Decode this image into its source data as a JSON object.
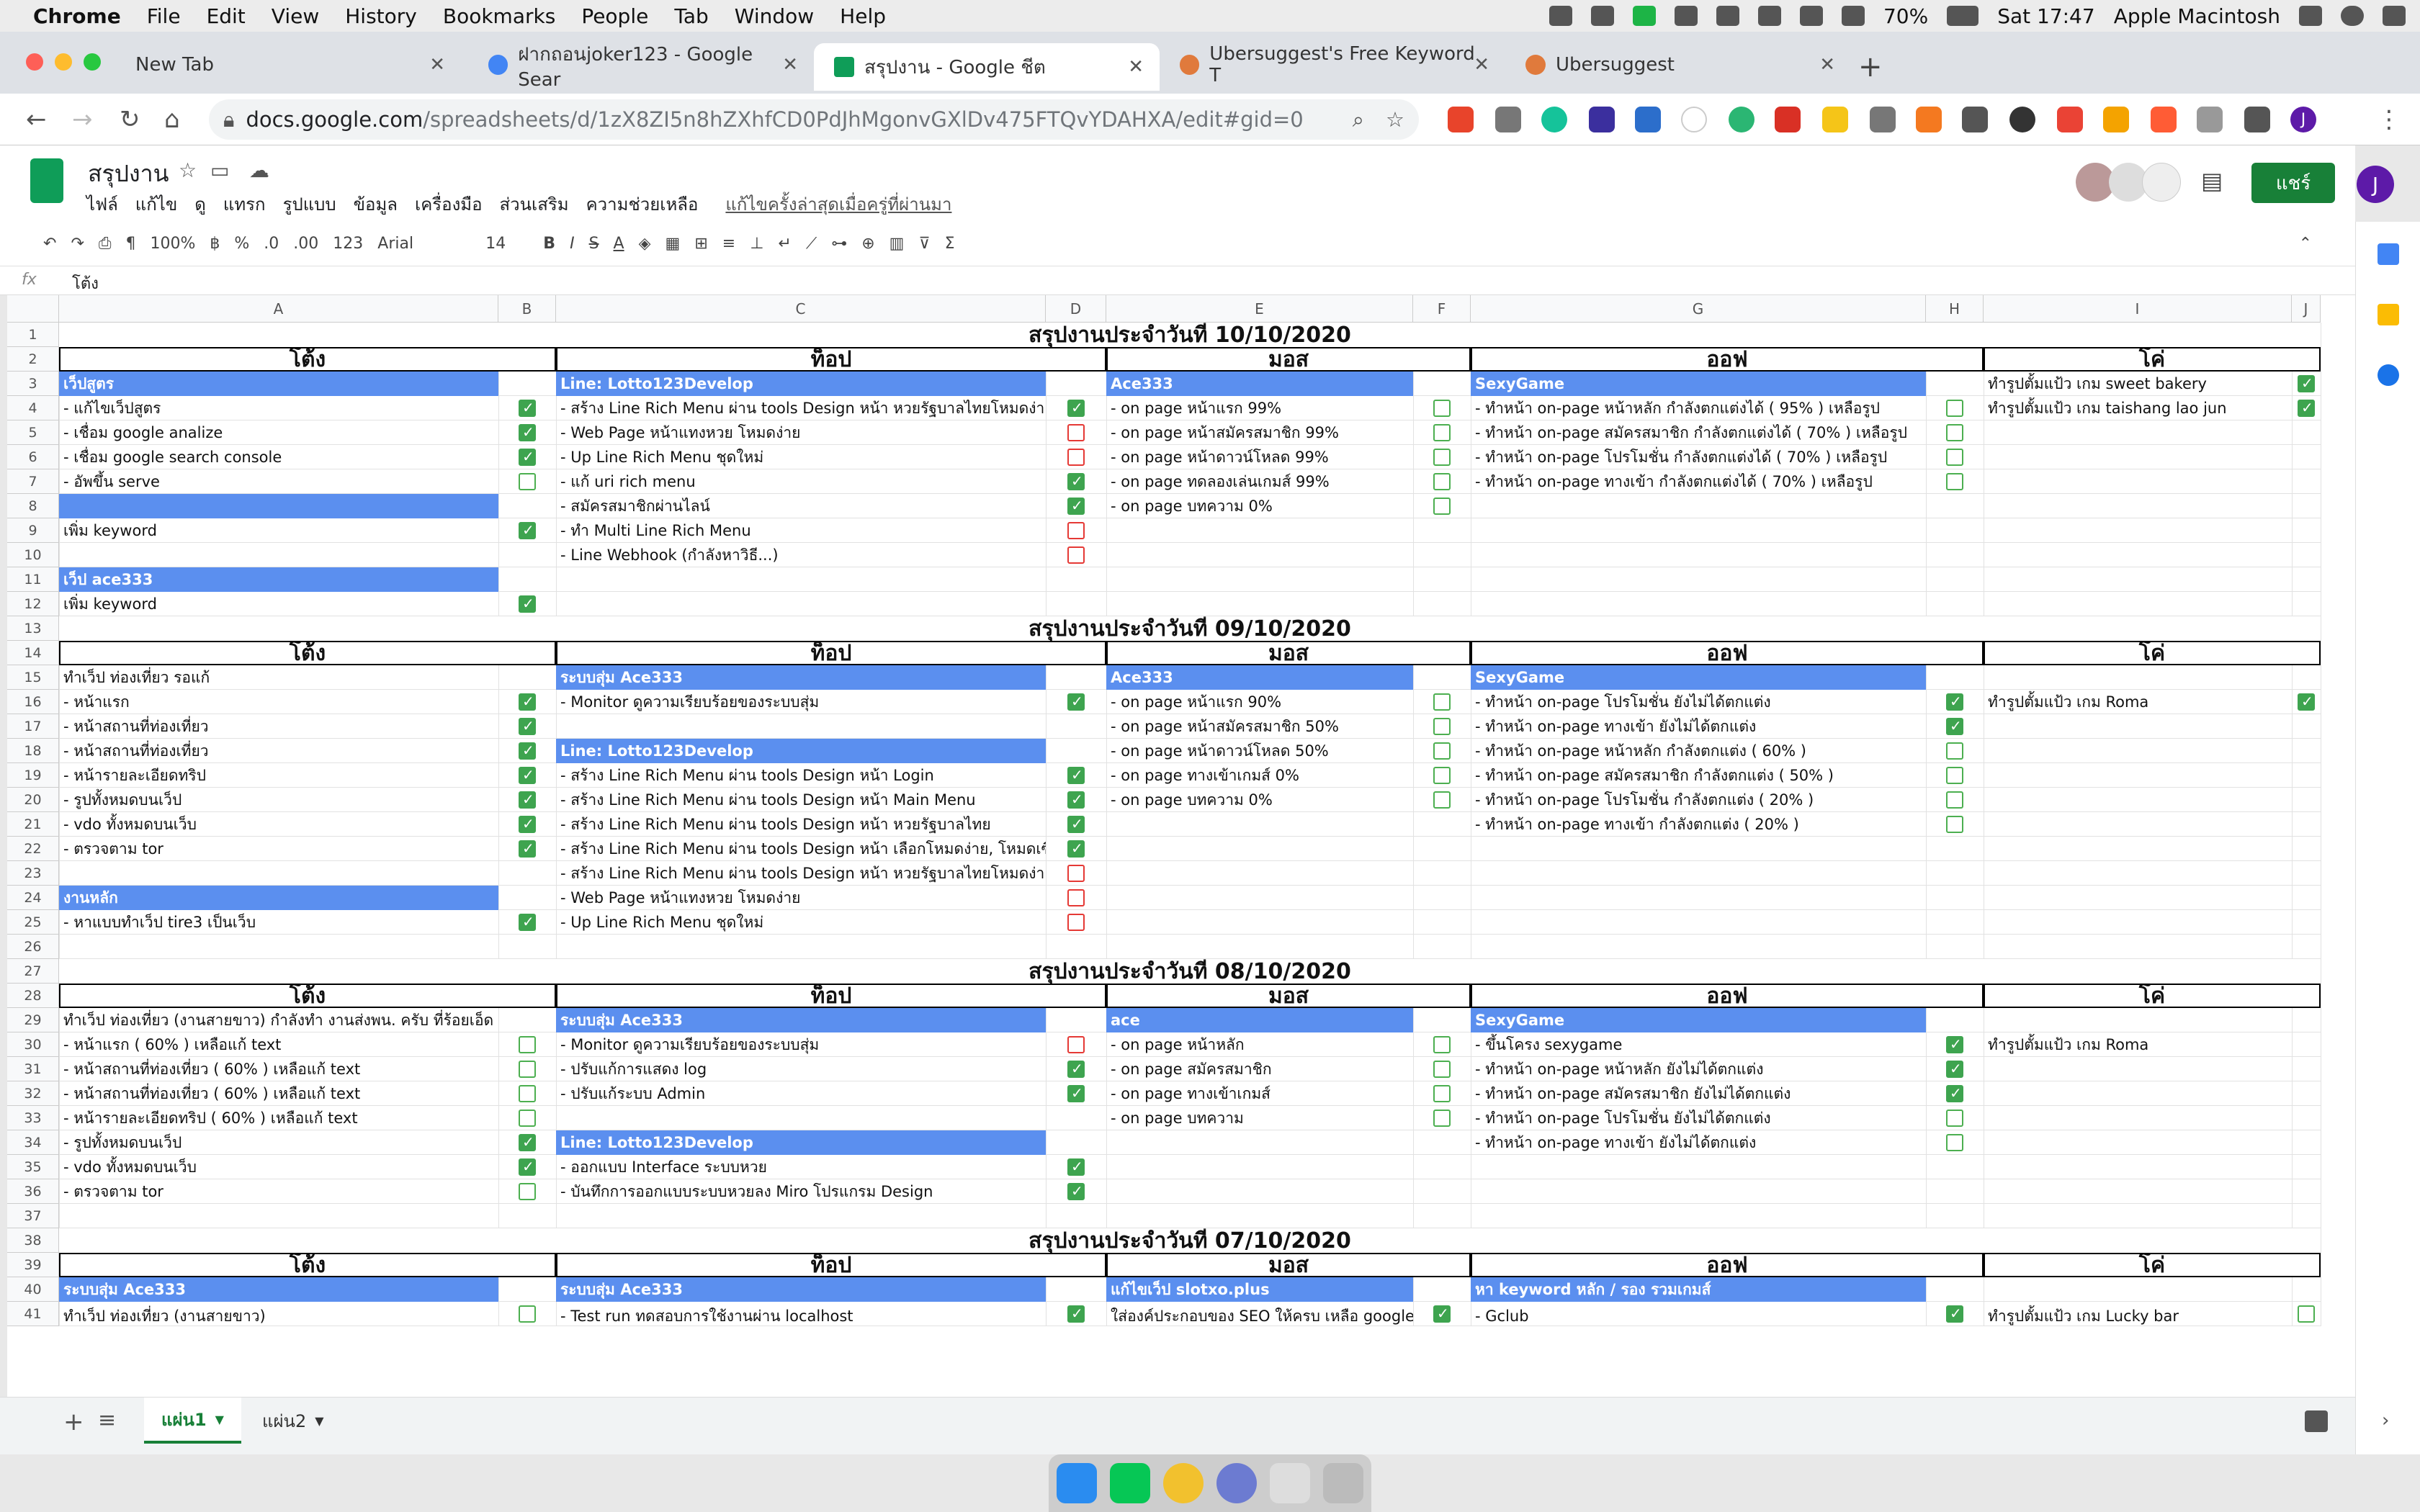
{
  "macbar": {
    "apple": "",
    "menu": [
      "Chrome",
      "File",
      "Edit",
      "View",
      "History",
      "Bookmarks",
      "People",
      "Tab",
      "Window",
      "Help"
    ],
    "battery": "70%",
    "clock": "Sat 17:47",
    "user": "Apple Macintosh"
  },
  "browser": {
    "tabs": [
      {
        "title": "New Tab"
      },
      {
        "title": "ฝากถอนjoker123 - Google Sear"
      },
      {
        "title": "สรุปงาน - Google ชีต"
      },
      {
        "title": "Ubersuggest's Free Keyword T"
      },
      {
        "title": "Ubersuggest"
      }
    ],
    "url_host": "docs.google.com",
    "url_path": "/spreadsheets/d/1zX8ZI5n8hZXhfCD0PdJhMgonvGXlDv475FTQvYDAHXA/edit#gid=0",
    "profile_initial": "J"
  },
  "sheets": {
    "doc_title": "สรุปงาน",
    "menus": [
      "ไฟล์",
      "แก้ไข",
      "ดู",
      "แทรก",
      "รูปแบบ",
      "ข้อมูล",
      "เครื่องมือ",
      "ส่วนเสริม",
      "ความช่วยเหลือ"
    ],
    "last_edit": "แก้ไขครั้งล่าสุดเมื่อครู่ที่ผ่านมา",
    "share": "แชร์",
    "account_initial": "J",
    "zoom": "100%",
    "font": "Arial",
    "font_size": "14",
    "currency": "฿",
    "percent": "%",
    "dec_less": ".0",
    "dec_more": ".00",
    "number_fmt": "123",
    "fx_label": "fx",
    "fx_value": "โต้ง",
    "sheet_tabs": [
      "แผ่น1",
      "แผ่น2"
    ]
  },
  "grid": {
    "cols": [
      "A",
      "B",
      "C",
      "D",
      "E",
      "F",
      "G",
      "H",
      "I",
      "J"
    ],
    "rows": [
      "1",
      "2",
      "3",
      "4",
      "5",
      "6",
      "7",
      "8",
      "9",
      "10",
      "11",
      "12",
      "13",
      "14",
      "15",
      "16",
      "17",
      "18",
      "19",
      "20",
      "21",
      "22",
      "23",
      "24",
      "25",
      "26",
      "27",
      "28",
      "29",
      "30",
      "31",
      "32",
      "33",
      "34",
      "35",
      "36",
      "37",
      "38",
      "39",
      "40",
      "41"
    ],
    "titles": [
      "สรุปงานประจำวันที่ 10/10/2020",
      "สรุปงานประจำวันที่ 09/10/2020",
      "สรุปงานประจำวันที่ 08/10/2020",
      "สรุปงานประจำวันที่ 07/10/2020"
    ],
    "people": [
      "โต้ง",
      "ท็อป",
      "มอส",
      "ออฟ",
      "โค่"
    ],
    "s1": {
      "tong": [
        {
          "r": 3,
          "t": "เว็ปสูตร",
          "blue": true
        },
        {
          "r": 4,
          "t": "- แก้ไขเว็ปสูตร",
          "cb": "on"
        },
        {
          "r": 5,
          "t": "- เชื่อม google analize",
          "cb": "on"
        },
        {
          "r": 6,
          "t": "- เชื่อม google search console",
          "cb": "on"
        },
        {
          "r": 7,
          "t": "- อัพขึ้น serve",
          "cb": "off"
        },
        {
          "r": 8,
          "t": "",
          "blue": true
        },
        {
          "r": 9,
          "t": "เพิ่ม keyword",
          "cb": "on"
        },
        {
          "r": 11,
          "t": "เว็ป ace333",
          "blue": true
        },
        {
          "r": 12,
          "t": "เพิ่ม keyword",
          "cb": "on"
        }
      ],
      "top": [
        {
          "r": 3,
          "t": "Line: Lotto123Develop",
          "blue": true
        },
        {
          "r": 4,
          "t": "- สร้าง Line Rich Menu ผ่าน tools Design หน้า หวยรัฐบาลไทยโหมดง่าย",
          "cb": "on"
        },
        {
          "r": 5,
          "t": "- Web Page หน้าแทงหวย โหมดง่าย",
          "cb": "red"
        },
        {
          "r": 6,
          "t": "- Up Line Rich Menu ชุดใหม่",
          "cb": "red"
        },
        {
          "r": 7,
          "t": "- แก้ uri rich menu",
          "cb": "on"
        },
        {
          "r": 8,
          "t": "- สมัครสมาชิกผ่านไลน์",
          "cb": "on"
        },
        {
          "r": 9,
          "t": "- ทำ Multi Line Rich Menu",
          "cb": "red"
        },
        {
          "r": 10,
          "t": "- Line Webhook (กำลังหาวิธี...)",
          "cb": "red"
        }
      ],
      "mos": [
        {
          "r": 3,
          "t": "Ace333",
          "blue": true
        },
        {
          "r": 4,
          "t": "- on page หน้าแรก 99%",
          "cb": "off"
        },
        {
          "r": 5,
          "t": "- on page หน้าสมัครสมาชิก 99%",
          "cb": "off"
        },
        {
          "r": 6,
          "t": "- on page หน้าดาวน์โหลด 99%",
          "cb": "off"
        },
        {
          "r": 7,
          "t": "- on page ทดลองเล่นเกมส์ 99%",
          "cb": "off"
        },
        {
          "r": 8,
          "t": "- on page บทความ 0%",
          "cb": "off"
        }
      ],
      "off": [
        {
          "r": 3,
          "t": "SexyGame",
          "blue": true
        },
        {
          "r": 4,
          "t": "- ทำหน้า on-page หน้าหลัก กำลังตกแต่งได้ ( 95% ) เหลือรูป",
          "cb": "off"
        },
        {
          "r": 5,
          "t": "- ทำหน้า on-page สมัครสมาชิก กำลังตกแต่งได้ ( 70% ) เหลือรูป",
          "cb": "off"
        },
        {
          "r": 6,
          "t": "- ทำหน้า on-page โปรโมชั่น กำลังตกแต่งได้ ( 70% ) เหลือรูป",
          "cb": "off"
        },
        {
          "r": 7,
          "t": "- ทำหน้า on-page ทางเข้า กำลังตกแต่งได้ ( 70% ) เหลือรูป",
          "cb": "off"
        }
      ],
      "ko": [
        {
          "r": 3,
          "t": "ทำรูปตั้มแป้ว เกม sweet bakery",
          "cb": "on"
        },
        {
          "r": 4,
          "t": "ทำรูปตั้มแป้ว เกม taishang lao jun",
          "cb": "on"
        }
      ]
    },
    "s2": {
      "tong": [
        {
          "r": 15,
          "t": "ทำเว็ป ท่องเที่ยว รอแก้"
        },
        {
          "r": 16,
          "t": "- หน้าแรก",
          "cb": "on"
        },
        {
          "r": 17,
          "t": "- หน้าสถานที่ท่องเที่ยว",
          "cb": "on"
        },
        {
          "r": 18,
          "t": "- หน้าสถานที่ท่องเที่ยว",
          "cb": "on"
        },
        {
          "r": 19,
          "t": "- หน้ารายละเอียดทริป",
          "cb": "on"
        },
        {
          "r": 20,
          "t": "- รูปทั้งหมดบนเว็ป",
          "cb": "on"
        },
        {
          "r": 21,
          "t": "- vdo ทั้งหมดบนเว็บ",
          "cb": "on"
        },
        {
          "r": 22,
          "t": "- ตรวจตาม tor",
          "cb": "on"
        },
        {
          "r": 24,
          "t": "งานหลัก",
          "blue": true
        },
        {
          "r": 25,
          "t": "- หาแบบทำเว็ป tire3 เป็นเว็บ",
          "cb": "on"
        }
      ],
      "top": [
        {
          "r": 15,
          "t": "ระบบสุ่ม Ace333",
          "blue": true
        },
        {
          "r": 16,
          "t": "- Monitor ดูความเรียบร้อยของระบบสุ่ม",
          "cb": "on"
        },
        {
          "r": 18,
          "t": "Line: Lotto123Develop",
          "blue": true
        },
        {
          "r": 19,
          "t": "- สร้าง Line Rich Menu ผ่าน tools Design หน้า Login",
          "cb": "on"
        },
        {
          "r": 20,
          "t": "- สร้าง Line Rich Menu ผ่าน tools Design หน้า Main Menu",
          "cb": "on"
        },
        {
          "r": 21,
          "t": "- สร้าง Line Rich Menu ผ่าน tools Design หน้า หวยรัฐบาลไทย",
          "cb": "on"
        },
        {
          "r": 22,
          "t": "- สร้าง Line Rich Menu ผ่าน tools Design หน้า เลือกโหมดง่าย, โหมดเซียน",
          "cb": "on"
        },
        {
          "r": 23,
          "t": "- สร้าง Line Rich Menu ผ่าน tools Design หน้า หวยรัฐบาลไทยโหมดง่าย",
          "cb": "red"
        },
        {
          "r": 24,
          "t": "- Web Page หน้าแทงหวย โหมดง่าย",
          "cb": "red"
        },
        {
          "r": 25,
          "t": "- Up Line Rich Menu ชุดใหม่",
          "cb": "red"
        }
      ],
      "mos": [
        {
          "r": 15,
          "t": "Ace333",
          "blue": true
        },
        {
          "r": 16,
          "t": "- on page หน้าแรก 90%",
          "cb": "off"
        },
        {
          "r": 17,
          "t": "- on page หน้าสมัครสมาชิก 50%",
          "cb": "off"
        },
        {
          "r": 18,
          "t": "- on page หน้าดาวน์โหลด 50%",
          "cb": "off"
        },
        {
          "r": 19,
          "t": "- on page ทางเข้าเกมส์ 0%",
          "cb": "off"
        },
        {
          "r": 20,
          "t": "- on page บทความ 0%",
          "cb": "off"
        }
      ],
      "off": [
        {
          "r": 15,
          "t": "SexyGame",
          "blue": true
        },
        {
          "r": 16,
          "t": "- ทำหน้า on-page โปรโมชั่น ยังไม่ได้ตกแต่ง",
          "cb": "on"
        },
        {
          "r": 17,
          "t": "- ทำหน้า on-page ทางเข้า ยังไม่ได้ตกแต่ง",
          "cb": "on"
        },
        {
          "r": 18,
          "t": "- ทำหน้า on-page หน้าหลัก กำลังตกแต่ง ( 60% )",
          "cb": "off"
        },
        {
          "r": 19,
          "t": "- ทำหน้า on-page สมัครสมาชิก กำลังตกแต่ง ( 50% )",
          "cb": "off"
        },
        {
          "r": 20,
          "t": "- ทำหน้า on-page โปรโมชั่น กำลังตกแต่ง ( 20% )",
          "cb": "off"
        },
        {
          "r": 21,
          "t": "- ทำหน้า on-page ทางเข้า กำลังตกแต่ง ( 20% )",
          "cb": "off"
        }
      ],
      "ko": [
        {
          "r": 16,
          "t": "ทำรูปตั้มแป้ว เกม Roma",
          "cb": "on"
        }
      ]
    },
    "s3": {
      "tong": [
        {
          "r": 29,
          "t": "ทำเว็ป ท่องเที่ยว (งานสายขาว) กำลังทำ งานส่งพน. ครับ ที่ร้อยเอ็ด"
        },
        {
          "r": 30,
          "t": "- หน้าแรก ( 60% ) เหลือแก้ text",
          "cb": "off"
        },
        {
          "r": 31,
          "t": "- หน้าสถานที่ท่องเที่ยว ( 60% ) เหลือแก้ text",
          "cb": "off"
        },
        {
          "r": 32,
          "t": "- หน้าสถานที่ท่องเที่ยว ( 60% ) เหลือแก้ text",
          "cb": "off"
        },
        {
          "r": 33,
          "t": "- หน้ารายละเอียดทริป ( 60% ) เหลือแก้ text",
          "cb": "off"
        },
        {
          "r": 34,
          "t": "- รูปทั้งหมดบนเว็ป",
          "cb": "on"
        },
        {
          "r": 35,
          "t": "- vdo ทั้งหมดบนเว็บ",
          "cb": "on"
        },
        {
          "r": 36,
          "t": "- ตรวจตาม tor",
          "cb": "off"
        }
      ],
      "top": [
        {
          "r": 29,
          "t": "ระบบสุ่ม Ace333",
          "blue": true
        },
        {
          "r": 30,
          "t": "- Monitor ดูความเรียบร้อยของระบบสุ่ม",
          "cb": "red"
        },
        {
          "r": 31,
          "t": "- ปรับแก้การแสดง log",
          "cb": "on"
        },
        {
          "r": 32,
          "t": "- ปรับแก้ระบบ Admin",
          "cb": "on"
        },
        {
          "r": 34,
          "t": "Line: Lotto123Develop",
          "blue": true
        },
        {
          "r": 35,
          "t": "- ออกแบบ Interface ระบบหวย",
          "cb": "on"
        },
        {
          "r": 36,
          "t": "- บันทึกการออกแบบระบบหวยลง Miro โปรแกรม Design",
          "cb": "on"
        }
      ],
      "mos": [
        {
          "r": 29,
          "t": "ace",
          "blue": true
        },
        {
          "r": 30,
          "t": " - on page หน้าหลัก",
          "cb": "off"
        },
        {
          "r": 31,
          "t": "- on page สมัครสมาชิก",
          "cb": "off"
        },
        {
          "r": 32,
          "t": "- on page ทางเข้าเกมส์",
          "cb": "off"
        },
        {
          "r": 33,
          "t": "- on page บทความ",
          "cb": "off"
        }
      ],
      "off": [
        {
          "r": 29,
          "t": "SexyGame",
          "blue": true
        },
        {
          "r": 30,
          "t": "- ขึ้นโครง sexygame",
          "cb": "on"
        },
        {
          "r": 31,
          "t": "- ทำหน้า on-page หน้าหลัก ยังไม่ได้ตกแต่ง",
          "cb": "on"
        },
        {
          "r": 32,
          "t": "- ทำหน้า on-page สมัครสมาชิก ยังไม่ได้ตกแต่ง",
          "cb": "on"
        },
        {
          "r": 33,
          "t": "- ทำหน้า on-page โปรโมชั่น ยังไม่ได้ตกแต่ง",
          "cb": "off"
        },
        {
          "r": 34,
          "t": "- ทำหน้า on-page ทางเข้า ยังไม่ได้ตกแต่ง",
          "cb": "off"
        }
      ],
      "ko": [
        {
          "r": 30,
          "t": "ทำรูปตั้มแป้ว เกม Roma"
        }
      ]
    },
    "s4": {
      "tong": [
        {
          "r": 40,
          "t": "ระบบสุ่ม Ace333",
          "blue": true
        },
        {
          "r": 41,
          "t": "ทำเว็ป ท่องเที่ยว (งานสายขาว)",
          "cb": "off"
        }
      ],
      "top": [
        {
          "r": 40,
          "t": "ระบบสุ่ม Ace333",
          "blue": true
        },
        {
          "r": 41,
          "t": "- Test run ทดสอบการใช้งานผ่าน localhost",
          "cb": "on"
        }
      ],
      "mos": [
        {
          "r": 40,
          "t": "แก้ไขเว็ป slotxo.plus",
          "blue": true
        },
        {
          "r": 41,
          "t": "ใส่องค์ประกอบของ SEO ให้ครบ เหลือ google alynatic",
          "cb": "on"
        }
      ],
      "off": [
        {
          "r": 40,
          "t": "หา keyword หลัก / รอง รวมเกมส์",
          "blue": true
        },
        {
          "r": 41,
          "t": "- Gclub",
          "cb": "on"
        }
      ],
      "ko": [
        {
          "r": 41,
          "t": "ทำรูปตั้มแป้ว เกม Lucky bar",
          "cb": "off"
        }
      ]
    }
  }
}
